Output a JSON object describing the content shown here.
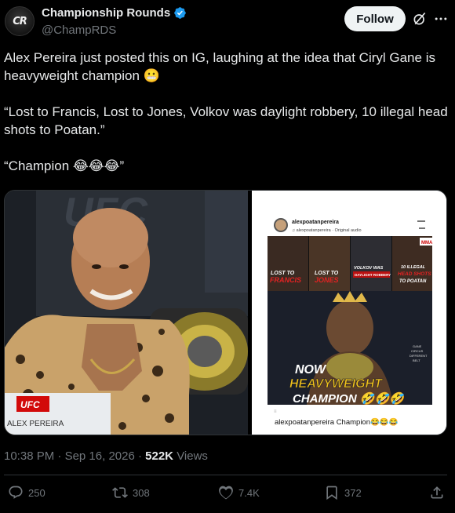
{
  "author": {
    "avatar_text": "CR",
    "display_name": "Championship Rounds",
    "handle": "@ChampRDS"
  },
  "header": {
    "follow_label": "Follow"
  },
  "tweet": {
    "line1": "Alex Pereira just posted this on IG, laughing at the idea that Ciryl Gane is heavyweight champion 😬",
    "line2": "“Lost to Francis, Lost to Jones, Volkov was daylight robbery, 10 illegal head shots to Poatan.”",
    "line3": "“Champion 😂😂😂”"
  },
  "media_left": {
    "backdrop_text": "UFC",
    "banner_text": "UFC",
    "nameplate_text": "ALEX PEREIRA"
  },
  "media_right": {
    "ig_username": "alexpoatanpereira",
    "ig_audio": "♫ alexpoatanpereira · Original audio",
    "panel1": "LOST TO FRANCIS",
    "panel2": "LOST TO JONES",
    "panel3": "VOLKOV WAS DAYLIGHT ROBBERY",
    "panel4": "10 ILLEGAL HEAD SHOTS TO POATAN",
    "mma_badge": "MMA",
    "side_note": "GANE CIRCUS DIFFERENT BELT",
    "now_text": "NOW",
    "heavyweight_text": "HEAVYWEIGHT",
    "champion_text": "CHAMPION 🤣🤣🤣",
    "caption": "alexpoatanpereira Champion😂😂😂"
  },
  "meta": {
    "time": "10:38 PM",
    "date": "Sep 16, 2026",
    "views_count": "522K",
    "views_label": "Views"
  },
  "actions": {
    "replies": "250",
    "reposts": "308",
    "likes": "7.4K",
    "bookmarks": "372"
  },
  "colors": {
    "background": "#000000",
    "text": "#e7e9ea",
    "muted": "#71767b",
    "verified": "#1d9bf0",
    "border": "#2f3336"
  }
}
